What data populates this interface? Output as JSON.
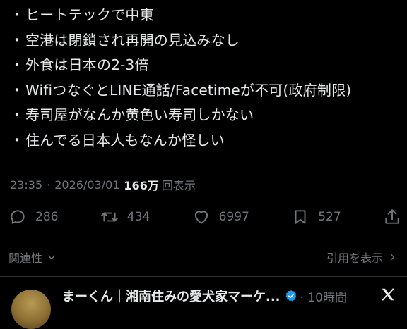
{
  "tweet": {
    "bullets": [
      "ヒートテックで中東",
      "空港は閉鎖され再開の見込みなし",
      "外食は日本の2-3倍",
      "WifiつなぐとLINE通話/Facetimeが不可(政府制限)",
      "寿司屋がなんか黄色い寿司しかない",
      "住んでる日本人もなんか怪しい"
    ],
    "bullet_marker": "・",
    "time": "23:35",
    "separator": "·",
    "date": "2026/03/01",
    "views_count": "166万",
    "views_label": "回表示"
  },
  "actions": {
    "replies": "286",
    "retweets": "434",
    "likes": "6997",
    "bookmarks": "527"
  },
  "footer": {
    "related": "関連性",
    "quotes": "引用を表示"
  },
  "reply": {
    "name": "まーくん｜湘南住みの愛犬家マーケ...",
    "time": "· 10時間",
    "verified_color": "#1d9bf0"
  },
  "icons": {
    "reply": "reply-icon",
    "retweet": "retweet-icon",
    "like": "heart-icon",
    "bookmark": "bookmark-icon",
    "share": "share-icon",
    "chevron": "chevron-down-icon",
    "chevron_right": "chevron-right-icon",
    "verified": "verified-badge-icon",
    "x_logo": "x-logo-icon"
  },
  "colors": {
    "background": "#000000",
    "text": "#e7e9ea",
    "muted": "#71767b",
    "divider": "#2f3336"
  }
}
